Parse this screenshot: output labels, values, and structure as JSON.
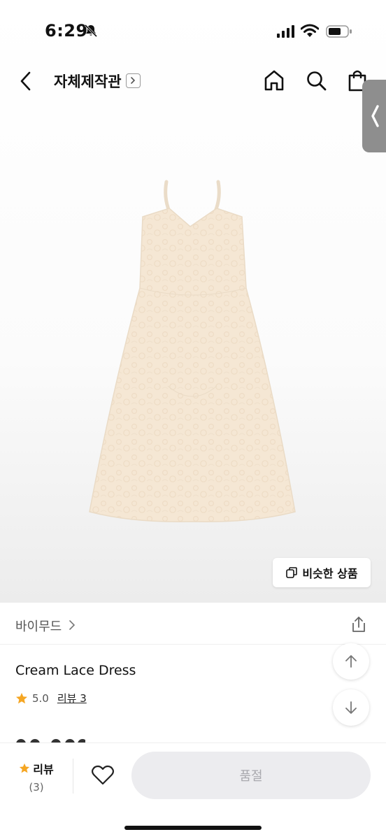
{
  "status": {
    "time": "6:29"
  },
  "nav": {
    "title": "자체제작관",
    "title_chevron": "›"
  },
  "hero": {
    "similar_label": "비슷한 상품"
  },
  "product": {
    "brand": "바이무드",
    "name": "Cream Lace Dress",
    "rating": "5.0",
    "review_link": "리뷰 3"
  },
  "bottom_bar": {
    "review_label": "리뷰",
    "review_count": "(3)",
    "cta_label": "품절"
  },
  "colors": {
    "star": "#f5a623",
    "dress": "#f5e7d4",
    "cta_bg": "#ececef",
    "cta_text": "#a9a9ae"
  }
}
